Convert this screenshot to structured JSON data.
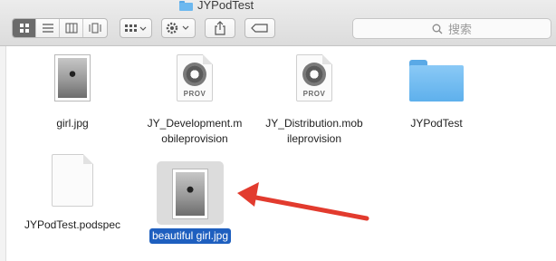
{
  "window": {
    "title": "JYPodTest"
  },
  "toolbar": {
    "view_icons": [
      "icon-view-icon",
      "list-view-icon",
      "column-view-icon",
      "cover-flow-icon"
    ],
    "group_icon": "arrange-grid-icon",
    "action_icon": "gear-icon",
    "share_icon": "share-icon",
    "tag_icon": "tag-icon"
  },
  "search": {
    "placeholder": "搜索"
  },
  "files": [
    {
      "name": "girl.jpg",
      "kind": "image"
    },
    {
      "name": "JY_Development.mobileprovision",
      "kind": "provision",
      "line1": "JY_Development.m",
      "line2": "obileprovision"
    },
    {
      "name": "JY_Distribution.mobileprovision",
      "kind": "provision",
      "line1": "JY_Distribution.mob",
      "line2": "ileprovision"
    },
    {
      "name": "JYPodTest",
      "kind": "folder"
    },
    {
      "name": "JYPodTest.podspec",
      "kind": "document"
    },
    {
      "name": "beautiful girl.jpg",
      "kind": "image",
      "selected": true
    }
  ],
  "prov_badge": "PROV",
  "colors": {
    "selection": "#1e5fbf",
    "arrow": "#e23b2e",
    "folder": "#6cb8ef"
  }
}
